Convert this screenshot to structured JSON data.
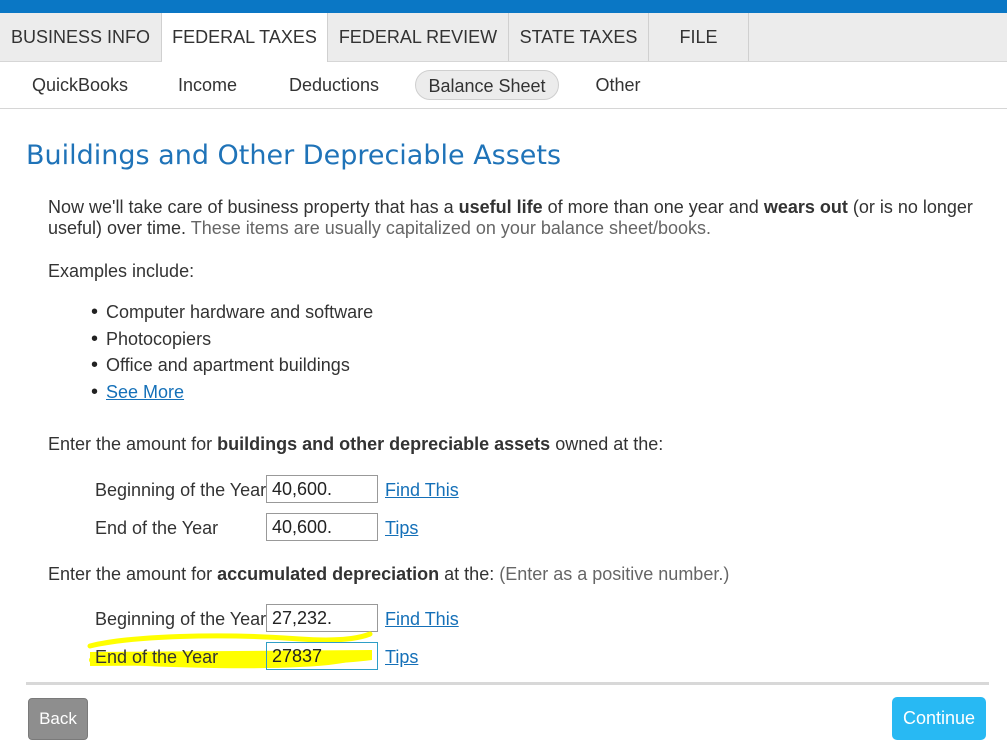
{
  "tabs": [
    "BUSINESS INFO",
    "FEDERAL TAXES",
    "FEDERAL REVIEW",
    "STATE TAXES",
    "FILE"
  ],
  "subnav": [
    "QuickBooks",
    "Income",
    "Deductions",
    "Balance Sheet",
    "Other"
  ],
  "page": {
    "title": "Buildings and Other Depreciable Assets",
    "intro_a": "Now we'll take care of business property that has a ",
    "intro_b": "useful life",
    "intro_c": " of more than one year and ",
    "intro_d": "wears out",
    "intro_e": " (or is no longer useful) over time.",
    "intro_note": " These items are usually capitalized on your balance sheet/books.",
    "examples_label": "Examples include:",
    "examples": [
      "Computer hardware and software",
      "Photocopiers",
      "Office and apartment buildings"
    ],
    "see_more": "See More"
  },
  "assets": {
    "prompt_a": "Enter the amount for ",
    "prompt_b": "buildings and other depreciable assets",
    "prompt_c": " owned at the:",
    "beg_label": "Beginning of the Year",
    "beg_value": "40,600.",
    "beg_link": "Find This",
    "end_label": "End of the Year",
    "end_value": "40,600.",
    "end_link": "Tips"
  },
  "depreciation": {
    "prompt_a": "Enter the amount for ",
    "prompt_b": "accumulated depreciation",
    "prompt_c": " at the: ",
    "prompt_note": "(Enter as a positive number.)",
    "beg_label": "Beginning of the Year",
    "beg_value": "27,232.",
    "beg_link": "Find This",
    "end_label": "End of the Year",
    "end_value": "27837",
    "end_link": "Tips"
  },
  "buttons": {
    "back": "Back",
    "continue": "Continue"
  },
  "colors": {
    "brand_blue": "#0a77c5",
    "title_blue": "#1f73b8",
    "continue_blue": "#28b9f3",
    "highlight_yellow": "#ffff00"
  }
}
